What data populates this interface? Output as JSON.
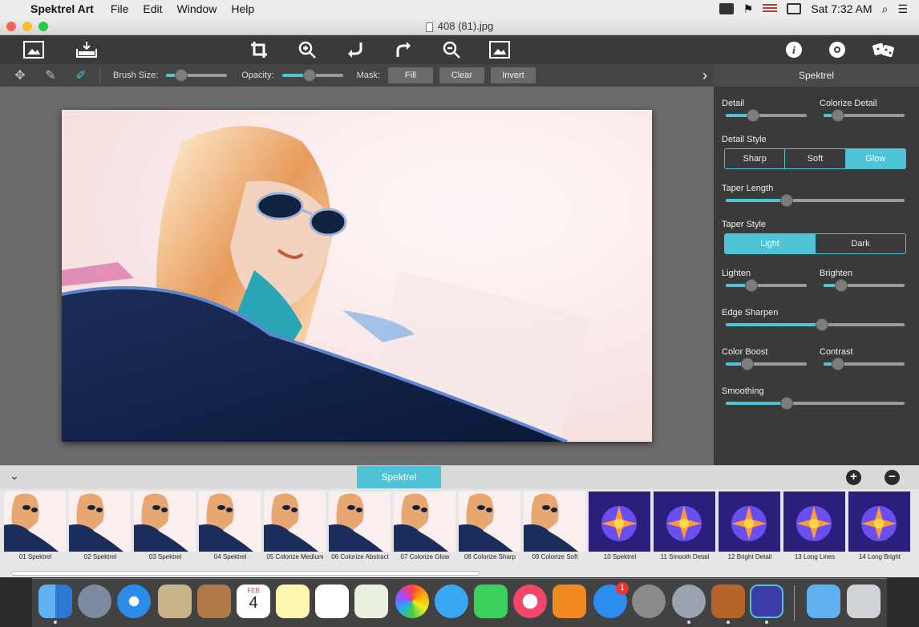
{
  "menubar": {
    "app_name": "Spektrel Art",
    "items": [
      "File",
      "Edit",
      "Window",
      "Help"
    ],
    "clock": "Sat 7:32 AM"
  },
  "window": {
    "title": "408 (81).jpg"
  },
  "subbar": {
    "brush_size_label": "Brush Size:",
    "opacity_label": "Opacity:",
    "mask_label": "Mask:",
    "fill_label": "Fill",
    "clear_label": "Clear",
    "invert_label": "Invert",
    "brush_size_value": 0.25,
    "opacity_value": 0.45
  },
  "panel": {
    "title": "Spektrel",
    "detail_label": "Detail",
    "colorize_detail_label": "Colorize Detail",
    "detail_value": 0.34,
    "colorize_detail_value": 0.18,
    "detail_style_label": "Detail Style",
    "detail_style_options": [
      "Sharp",
      "Soft",
      "Glow"
    ],
    "detail_style_selected": "Glow",
    "taper_length_label": "Taper Length",
    "taper_length_value": 0.34,
    "taper_style_label": "Taper Style",
    "taper_style_options": [
      "Light",
      "Dark"
    ],
    "taper_style_selected": "Light",
    "lighten_label": "Lighten",
    "brighten_label": "Brighten",
    "lighten_value": 0.32,
    "brighten_value": 0.22,
    "edge_sharpen_label": "Edge Sharpen",
    "edge_sharpen_value": 0.54,
    "color_boost_label": "Color Boost",
    "contrast_label": "Contrast",
    "color_boost_value": 0.27,
    "contrast_value": 0.18,
    "smoothing_label": "Smoothing",
    "smoothing_value": 0.34
  },
  "bottom": {
    "tab_label": "Spektrel",
    "presets": [
      {
        "label": "01 Spektrel",
        "kind": "woman"
      },
      {
        "label": "02 Spektrel",
        "kind": "woman"
      },
      {
        "label": "03 Spektrel",
        "kind": "woman"
      },
      {
        "label": "04 Spektrel",
        "kind": "woman"
      },
      {
        "label": "05 Colorize Medium",
        "kind": "woman"
      },
      {
        "label": "06 Colorize Abstract",
        "kind": "woman"
      },
      {
        "label": "07 Colorize Glow",
        "kind": "woman"
      },
      {
        "label": "08 Colorize Sharp",
        "kind": "woman"
      },
      {
        "label": "09 Colorize Soft",
        "kind": "woman"
      },
      {
        "label": "10 Spektrel",
        "kind": "flower"
      },
      {
        "label": "11 Smooth Detail",
        "kind": "flower"
      },
      {
        "label": "12 Bright Detail",
        "kind": "flower"
      },
      {
        "label": "13 Long Lines",
        "kind": "flower"
      },
      {
        "label": "14 Long Bright",
        "kind": "flower"
      }
    ]
  },
  "dock": {
    "calendar_month": "FEB",
    "calendar_day": "4",
    "app_store_badge": "1"
  },
  "colors": {
    "accent": "#4fc3d6",
    "panel": "#3a3a3a",
    "canvas": "#6b6b6b"
  }
}
